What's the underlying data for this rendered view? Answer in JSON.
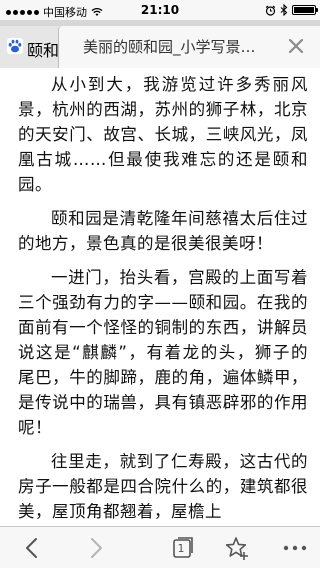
{
  "status_bar": {
    "carrier": "中国移动",
    "time": "21:10",
    "battery_level": 1.0
  },
  "tabs": [
    {
      "title": "颐和",
      "favicon": "baidu-paw-icon",
      "active": false
    },
    {
      "title": "美丽的颐和园_小学写景…",
      "active": true
    }
  ],
  "article": {
    "paragraphs": [
      "从小到大，我游览过许多秀丽风景，杭州的西湖，苏州的狮子林，北京的天安门、故宫、长城，三峡风光，凤凰古城……但最使我难忘的还是颐和园。",
      "颐和园是清乾隆年间慈禧太后住过的地方，景色真的是很美很美呀！",
      "一进门，抬头看，宫殿的上面写着三个强劲有力的字——颐和园。在我的面前有一个怪怪的铜制的东西，讲解员说这是“麒麟”，有着龙的头，狮子的尾巴，牛的脚蹄，鹿的角，遍体鳞甲，是传说中的瑞兽，具有镇恶辟邪的作用呢！",
      "往里走，就到了仁寿殿，这古代的房子一般都是四合院什么的，建筑都很美，屋顶角都翘着，屋檐上"
    ]
  },
  "toolbar": {
    "tab_count": "1",
    "icons": [
      "back-arrow-icon",
      "forward-arrow-icon",
      "tabs-icon",
      "bookmark-star-icon",
      "more-icon"
    ]
  },
  "colors": {
    "tab_bar": "#d7d7d7",
    "accent_gray": "#888888",
    "baidu_blue": "#2a5fd6"
  }
}
